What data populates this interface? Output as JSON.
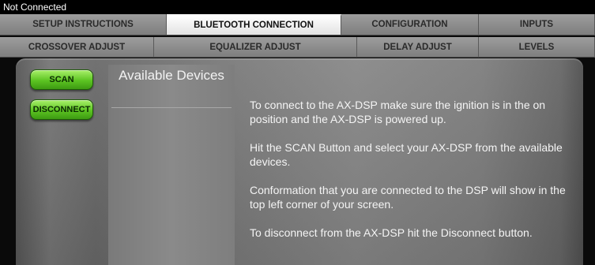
{
  "status": {
    "connection": "Not Connected"
  },
  "tabs_row1": [
    {
      "label": "SETUP INSTRUCTIONS",
      "active": false
    },
    {
      "label": "BLUETOOTH CONNECTION",
      "active": true
    },
    {
      "label": "CONFIGURATION",
      "active": false
    },
    {
      "label": "INPUTS",
      "active": false
    }
  ],
  "tabs_row2": [
    {
      "label": "CROSSOVER ADJUST",
      "active": false
    },
    {
      "label": "EQUALIZER ADJUST",
      "active": false
    },
    {
      "label": "DELAY ADJUST",
      "active": false
    },
    {
      "label": "LEVELS",
      "active": false
    }
  ],
  "buttons": {
    "scan": "SCAN",
    "disconnect": "DISCONNECT"
  },
  "devices": {
    "title": "Available Devices",
    "list": []
  },
  "instructions": [
    "To connect to the AX-DSP make sure the ignition is in the on position and the AX-DSP is powered up.",
    "Hit the SCAN Button and select your AX-DSP from the available devices.",
    "Conformation that you are connected to the DSP will show in the top left corner of your screen.",
    "To disconnect from the AX-DSP hit the Disconnect button."
  ],
  "colors": {
    "button_green": "#5cc422",
    "active_tab": "#ffffff",
    "tab": "#8c8c8c",
    "panel": "#7c7c7c"
  }
}
